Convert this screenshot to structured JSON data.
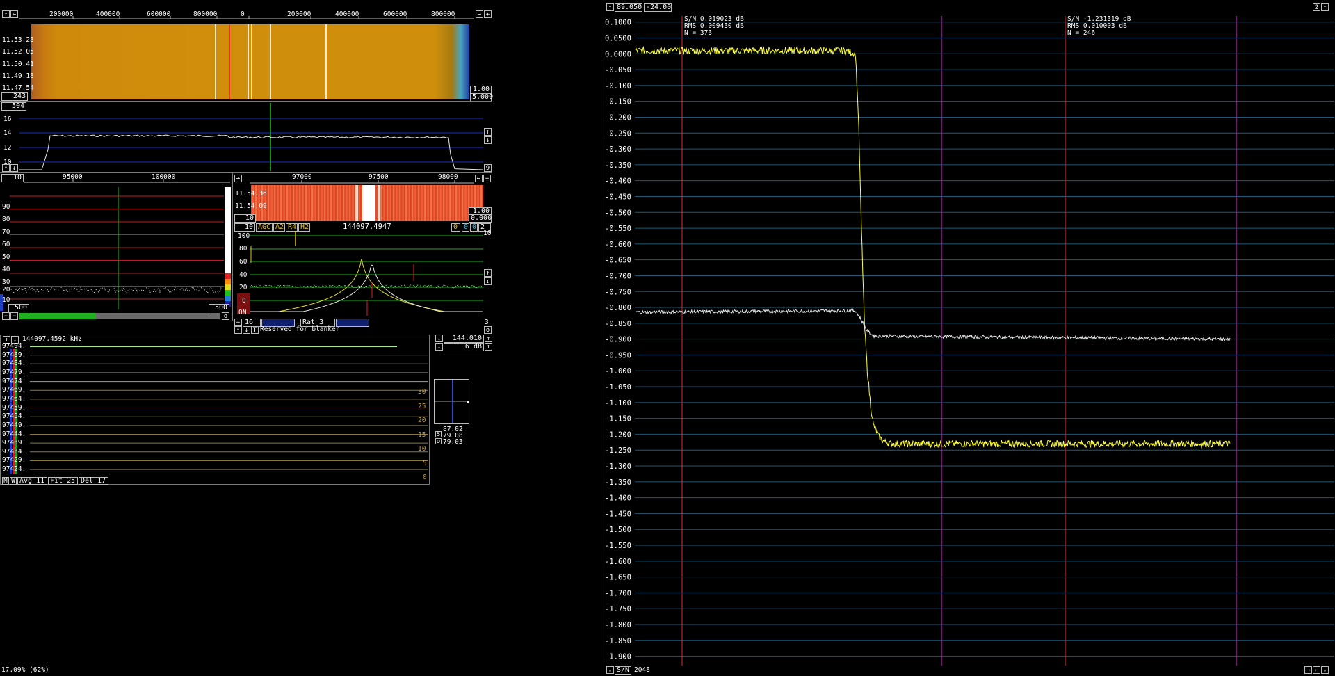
{
  "wf_top": {
    "freq_ticks": [
      "200000",
      "400000",
      "600000",
      "800000",
      "0",
      "200000",
      "400000",
      "600000",
      "800000"
    ],
    "times": [
      "11.53.28",
      "11.52.05",
      "11.50.41",
      "11.49.18",
      "11.47.54"
    ],
    "count": "243",
    "gain": "1.00",
    "zero": "5.000"
  },
  "spec_top": {
    "avg": "504",
    "y_ticks": [
      "16",
      "14",
      "12",
      "10"
    ],
    "nine": "9"
  },
  "hires": {
    "ten": "10",
    "freq_ticks": [
      "95000",
      "100000"
    ],
    "y_ticks": [
      "90",
      "80",
      "70",
      "60",
      "50",
      "40",
      "30",
      "20",
      "10"
    ],
    "left_count": "500",
    "right_count": "500",
    "o_label": "o"
  },
  "bb_wf": {
    "freq_ticks": [
      "97000",
      "97500",
      "98000"
    ],
    "times": [
      "11.54.36",
      "11.54.09"
    ],
    "ten": "10",
    "gain": "1.00",
    "zero": "0.000"
  },
  "baseband": {
    "ten_left": "10",
    "agc": "AGC",
    "a2": "A2",
    "r4": "R4",
    "h2": "H2",
    "freq": "144097.4947",
    "b0": "0",
    "b1": "0",
    "b2": "0",
    "b3": "2",
    "ten_right": "10",
    "y_ticks": [
      "100",
      "80",
      "60",
      "40",
      "20",
      "0",
      "ON"
    ],
    "sixteen": "16",
    "rat": "Rat  3",
    "three": "3",
    "blanker": "Reserved for blanker",
    "t_label": "T",
    "o_label": "o"
  },
  "meteor": {
    "freq": "144097.4592 kHz",
    "rows": [
      "97494.",
      "97489.",
      "97484.",
      "97479.",
      "97474.",
      "97469.",
      "97464.",
      "97459.",
      "97454.",
      "97449.",
      "97444.",
      "97439.",
      "97434.",
      "97429.",
      "97424."
    ],
    "scale": [
      "30",
      "25",
      "20",
      "15",
      "10",
      "5",
      "0"
    ],
    "m": "M",
    "w": "W",
    "avg": "Avg 11",
    "fit": "Fit 25",
    "del": "Del 17"
  },
  "side": {
    "freq": "144.010",
    "db": "6 dB",
    "v1": "87.02",
    "v2": "79.08",
    "v3": "79.03",
    "s": "S",
    "o": "o"
  },
  "status": {
    "text": "17.09% (62%)"
  },
  "big": {
    "top_left": "89.050",
    "top_mid": "-24.00",
    "top_right": "2",
    "left_stats": [
      "S/N 0.019023 dB",
      "RMS 0.009430 dB",
      "N = 373"
    ],
    "right_stats": [
      "S/N -1.231319 dB",
      "RMS 0.010003 dB",
      "N = 246"
    ],
    "y_ticks": [
      "0.1000",
      "0.0500",
      "0.0000",
      "-0.050",
      "-0.100",
      "-0.150",
      "-0.200",
      "-0.250",
      "-0.300",
      "-0.350",
      "-0.400",
      "-0.450",
      "-0.500",
      "-0.550",
      "-0.600",
      "-0.650",
      "-0.700",
      "-0.750",
      "-0.800",
      "-0.850",
      "-0.900",
      "-0.950",
      "-1.000",
      "-1.050",
      "-1.100",
      "-1.150",
      "-1.200",
      "-1.250",
      "-1.300",
      "-1.350",
      "-1.400",
      "-1.450",
      "-1.500",
      "-1.550",
      "-1.600",
      "-1.650",
      "-1.700",
      "-1.750",
      "-1.800",
      "-1.850",
      "-1.900"
    ],
    "sn": "S/N",
    "n": "2048"
  },
  "chart_data": {
    "type": "line",
    "ylim": [
      -1.925,
      0.1125
    ],
    "series": [
      {
        "color": "#ffff40",
        "x": [
          0,
          0.35,
          0.37,
          0.375,
          0.38,
          0.385,
          0.39,
          0.395,
          0.4,
          0.41,
          0.42,
          0.43,
          1.0
        ],
        "values": [
          0.01,
          0.01,
          0.0,
          -0.2,
          -0.55,
          -0.85,
          -1.0,
          -1.1,
          -1.17,
          -1.21,
          -1.225,
          -1.23,
          -1.23
        ]
      },
      {
        "color": "#e8e8e8",
        "x": [
          0,
          0.37,
          0.38,
          0.39,
          0.4,
          1.0
        ],
        "values": [
          -0.815,
          -0.81,
          -0.84,
          -0.875,
          -0.89,
          -0.9
        ]
      }
    ]
  }
}
